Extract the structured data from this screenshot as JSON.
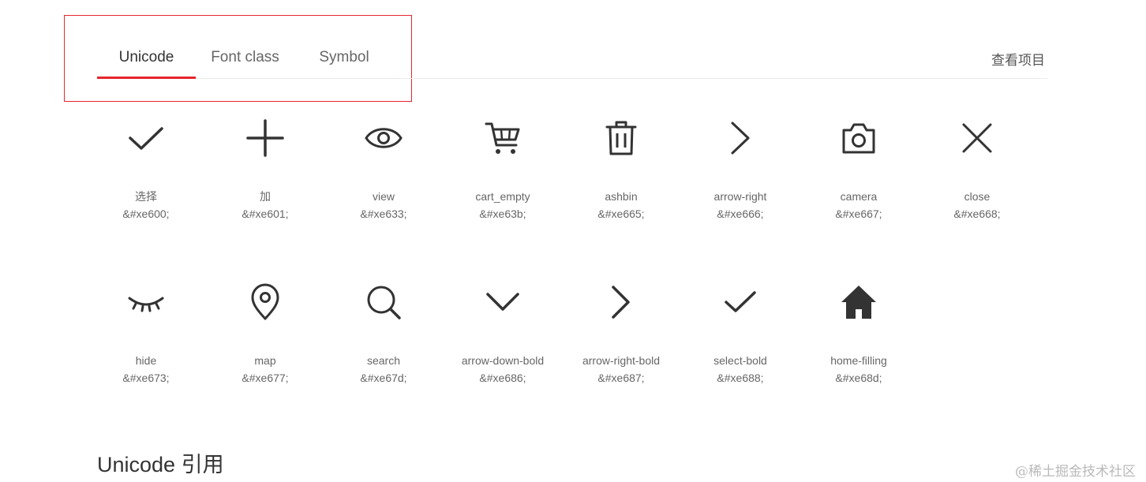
{
  "tabs": [
    {
      "label": "Unicode",
      "active": true
    },
    {
      "label": "Font class",
      "active": false
    },
    {
      "label": "Symbol",
      "active": false
    }
  ],
  "header": {
    "view_project": "查看项目"
  },
  "icons": [
    {
      "name": "选择",
      "code": "&#xe600;",
      "icon": "check-icon"
    },
    {
      "name": "加",
      "code": "&#xe601;",
      "icon": "plus-icon"
    },
    {
      "name": "view",
      "code": "&#xe633;",
      "icon": "eye-icon"
    },
    {
      "name": "cart_empty",
      "code": "&#xe63b;",
      "icon": "cart-icon"
    },
    {
      "name": "ashbin",
      "code": "&#xe665;",
      "icon": "trash-icon"
    },
    {
      "name": "arrow-right",
      "code": "&#xe666;",
      "icon": "chevron-right-icon"
    },
    {
      "name": "camera",
      "code": "&#xe667;",
      "icon": "camera-icon"
    },
    {
      "name": "close",
      "code": "&#xe668;",
      "icon": "close-icon"
    },
    {
      "name": "hide",
      "code": "&#xe673;",
      "icon": "eye-closed-icon"
    },
    {
      "name": "map",
      "code": "&#xe677;",
      "icon": "map-pin-icon"
    },
    {
      "name": "search",
      "code": "&#xe67d;",
      "icon": "search-icon"
    },
    {
      "name": "arrow-down-bold",
      "code": "&#xe686;",
      "icon": "chevron-down-icon"
    },
    {
      "name": "arrow-right-bold",
      "code": "&#xe687;",
      "icon": "chevron-right-bold-icon"
    },
    {
      "name": "select-bold",
      "code": "&#xe688;",
      "icon": "check-bold-icon"
    },
    {
      "name": "home-filling",
      "code": "&#xe68d;",
      "icon": "home-icon"
    }
  ],
  "section": {
    "title": "Unicode 引用"
  },
  "watermark": "@稀土掘金技术社区",
  "colors": {
    "accent": "#e5262d",
    "icon": "#333333",
    "text_muted": "#666666"
  }
}
